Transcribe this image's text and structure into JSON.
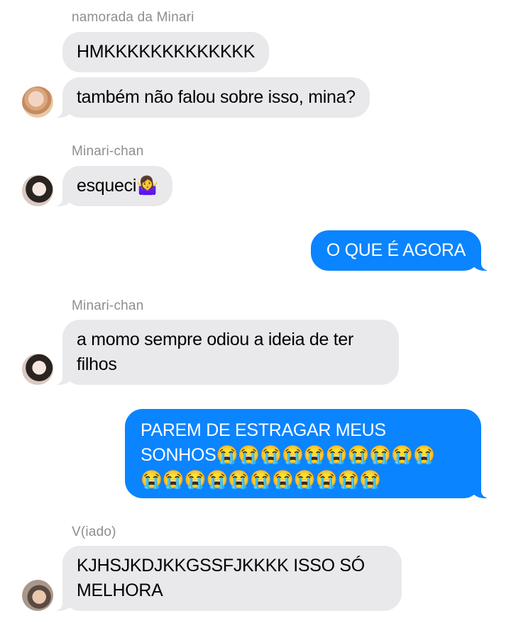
{
  "messages": [
    {
      "sender": "namorada da Minari",
      "texts": [
        "HMKKKKKKKKKKKKK",
        "também não falou sobre isso, mina?"
      ]
    },
    {
      "sender": "Minari-chan",
      "texts": [
        "esqueci🤷‍♀️"
      ]
    },
    {
      "me": "O QUE É AGORA"
    },
    {
      "sender": "Minari-chan",
      "lines": [
        "a momo sempre odiou a ideia de ter",
        "filhos"
      ]
    },
    {
      "me_lines": [
        "PAREM DE ESTRAGAR MEUS",
        "SONHOS😭😭😭😭😭😭😭😭😭😭",
        "😭😭😭😭😭😭😭😭😭😭😭"
      ]
    },
    {
      "sender": "V(iado)",
      "lines": [
        "KJHSJKDJKKGSSFJKKKK ISSO SÓ",
        "MELHORA"
      ]
    }
  ]
}
